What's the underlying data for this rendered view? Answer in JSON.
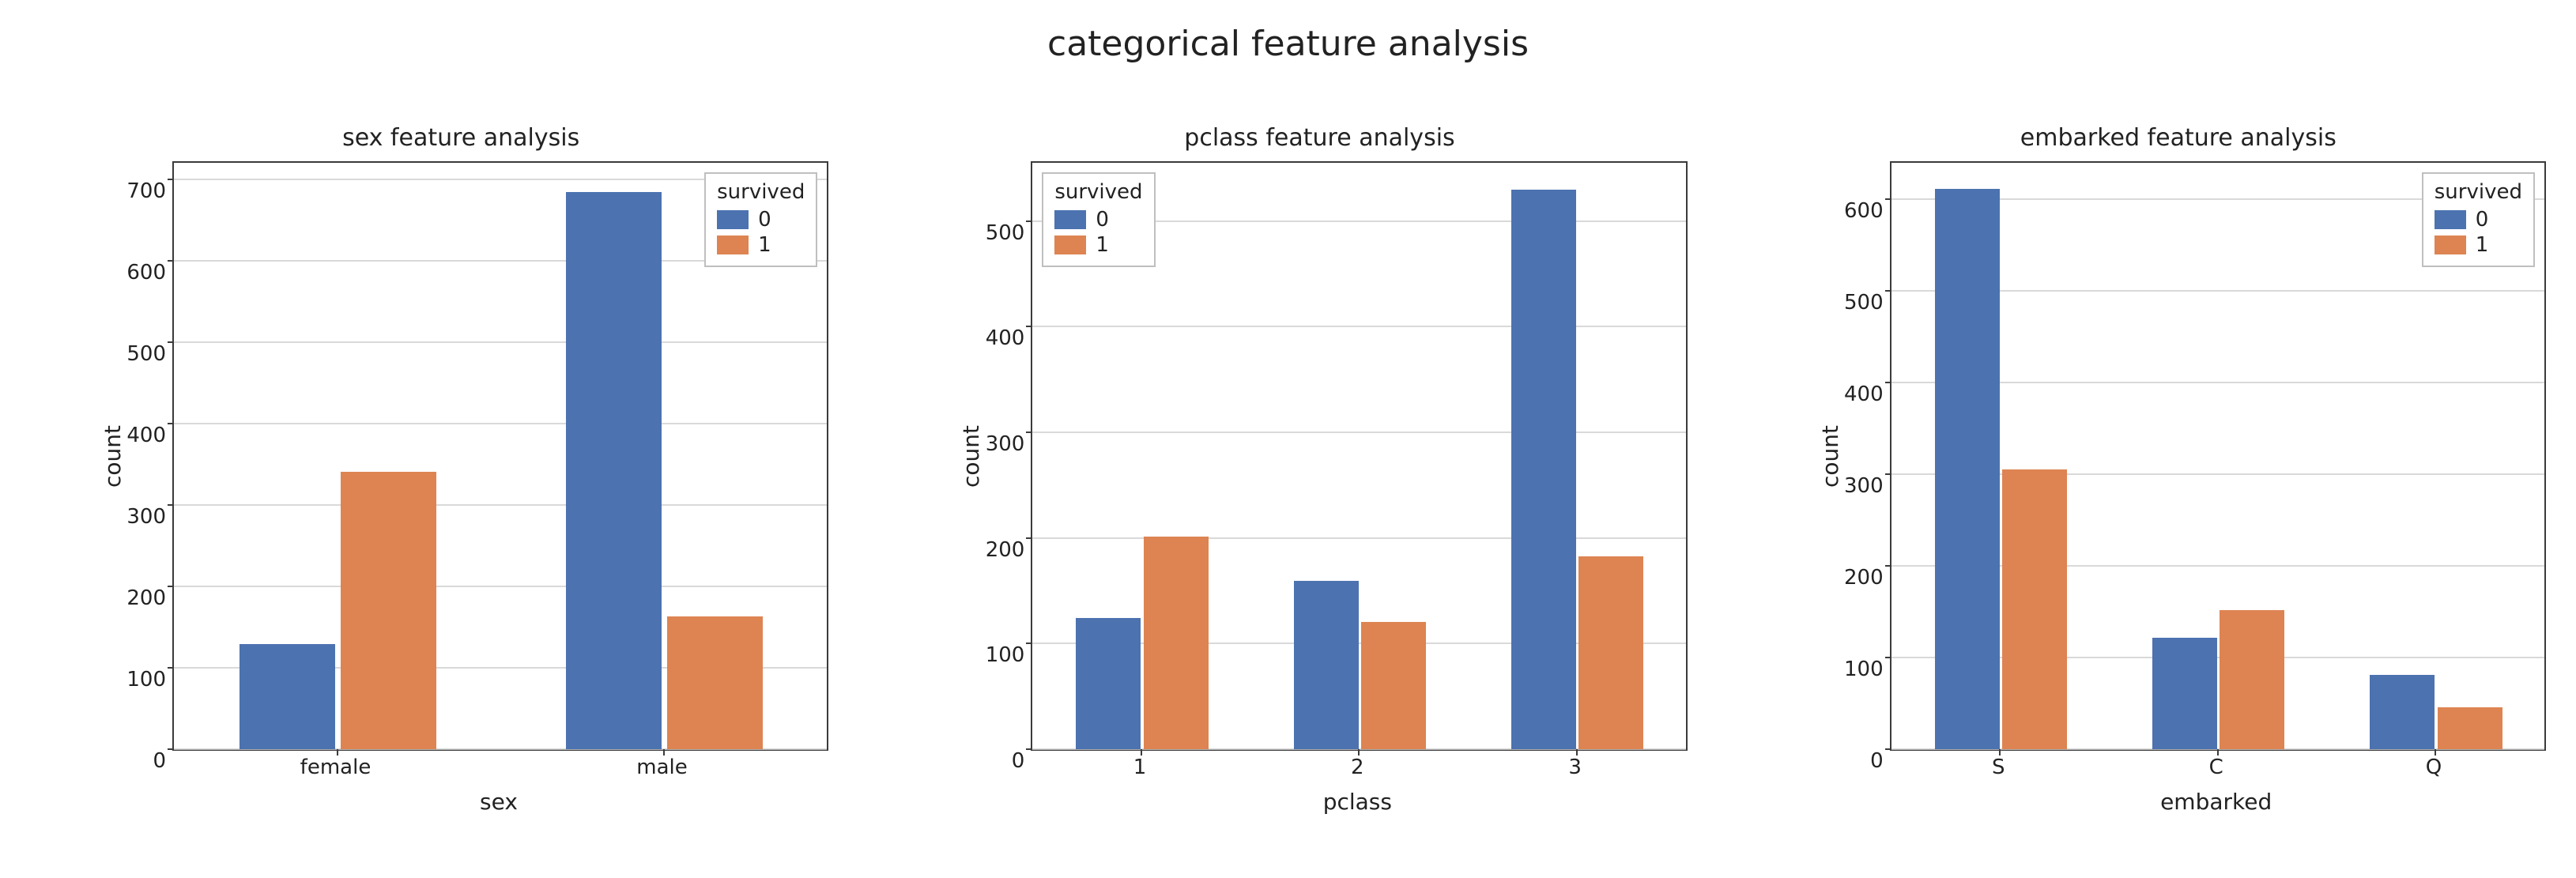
{
  "suptitle": "categorical feature analysis",
  "colors": {
    "series0": "#4c72b0",
    "series1": "#dd8452"
  },
  "legend": {
    "title": "survived",
    "items": [
      "0",
      "1"
    ]
  },
  "chart_data": [
    {
      "type": "bar",
      "title": "sex feature analysis",
      "xlabel": "sex",
      "ylabel": "count",
      "categories": [
        "female",
        "male"
      ],
      "series": [
        {
          "name": "0",
          "values": [
            127,
            682
          ]
        },
        {
          "name": "1",
          "values": [
            339,
            161
          ]
        }
      ],
      "ylim": [
        0,
        720
      ],
      "yticks": [
        0,
        100,
        200,
        300,
        400,
        500,
        600,
        700
      ],
      "legend_pos": "top-right"
    },
    {
      "type": "bar",
      "title": "pclass feature analysis",
      "xlabel": "pclass",
      "ylabel": "count",
      "categories": [
        "1",
        "2",
        "3"
      ],
      "series": [
        {
          "name": "0",
          "values": [
            123,
            158,
            528
          ]
        },
        {
          "name": "1",
          "values": [
            200,
            119,
            181
          ]
        }
      ],
      "ylim": [
        0,
        555
      ],
      "yticks": [
        0,
        100,
        200,
        300,
        400,
        500
      ],
      "legend_pos": "top-left"
    },
    {
      "type": "bar",
      "title": "embarked feature analysis",
      "xlabel": "embarked",
      "ylabel": "count",
      "categories": [
        "S",
        "C",
        "Q"
      ],
      "series": [
        {
          "name": "0",
          "values": [
            610,
            120,
            79
          ]
        },
        {
          "name": "1",
          "values": [
            304,
            150,
            44
          ]
        }
      ],
      "ylim": [
        0,
        640
      ],
      "yticks": [
        0,
        100,
        200,
        300,
        400,
        500,
        600
      ],
      "legend_pos": "top-right"
    }
  ]
}
